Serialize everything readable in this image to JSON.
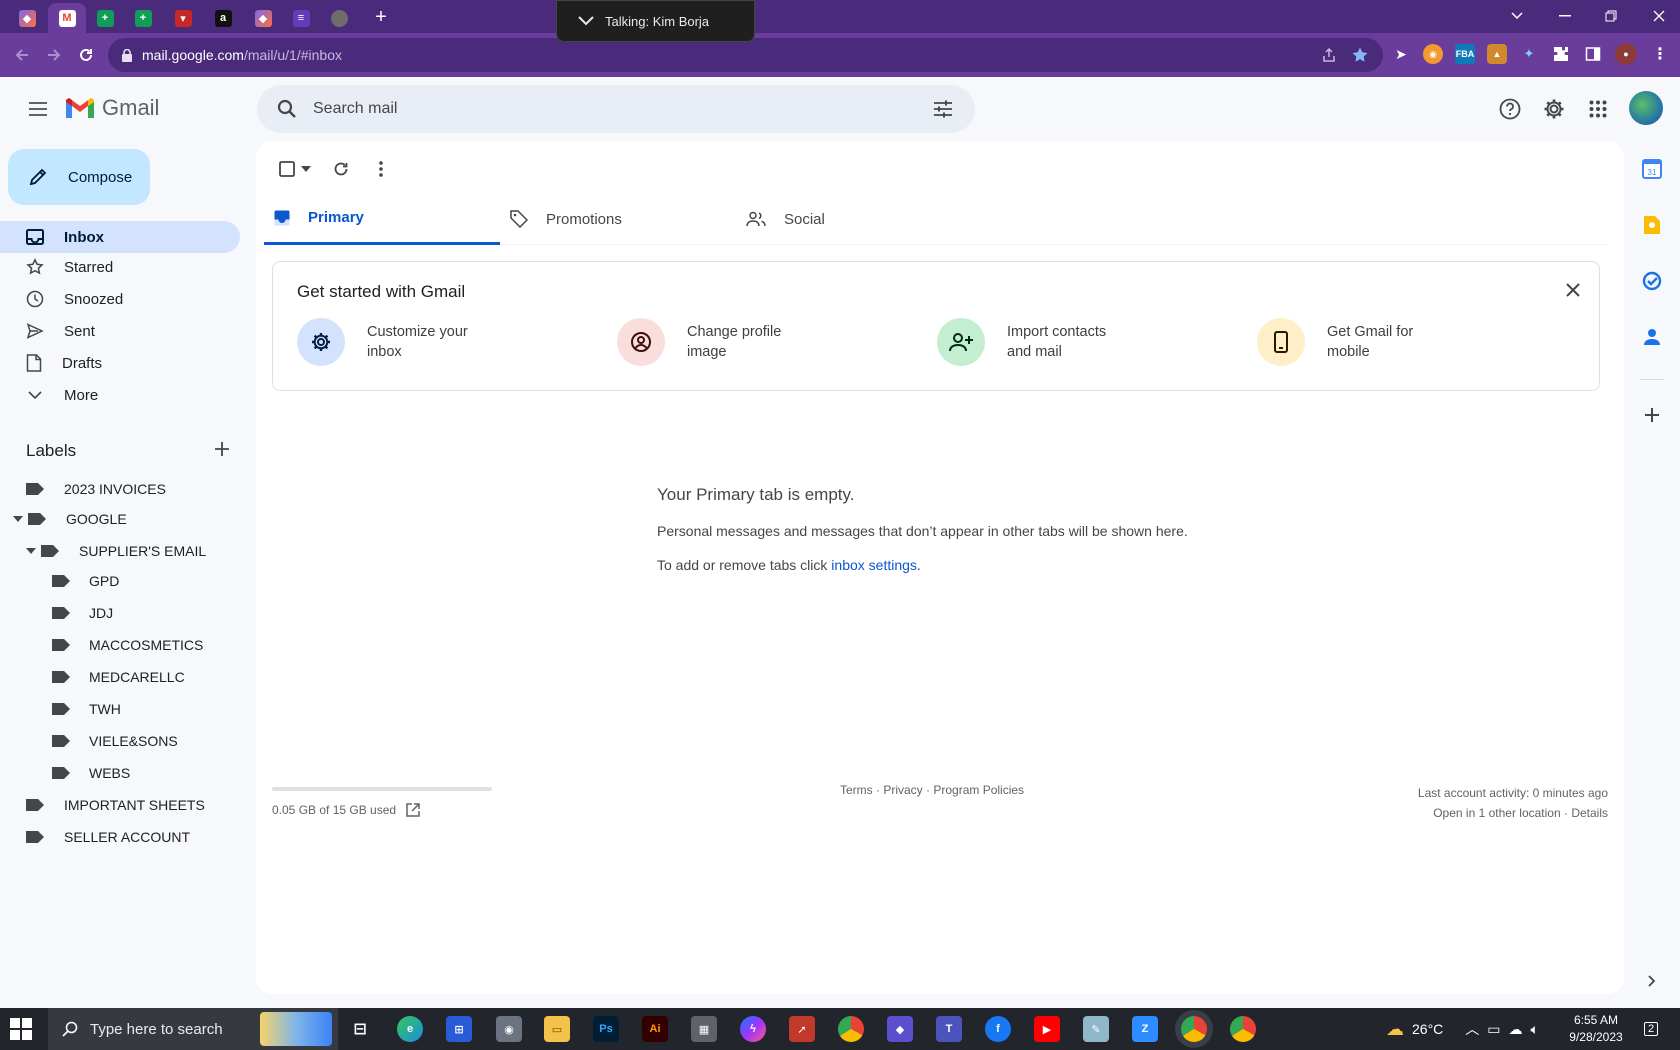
{
  "browser": {
    "tabs": [
      {
        "icon": "clickup-icon"
      },
      {
        "icon": "gmail-icon"
      },
      {
        "icon": "google-sheets-icon"
      },
      {
        "icon": "google-sheets-icon"
      },
      {
        "icon": "tab-site-icon"
      },
      {
        "icon": "amazon-icon"
      },
      {
        "icon": "clickup-icon"
      },
      {
        "icon": "google-forms-icon"
      },
      {
        "icon": "loading-tab-icon"
      }
    ],
    "call_indicator": "Talking: Kim Borja",
    "url_host": "mail.google.com",
    "url_path": "/mail/u/1/#inbox"
  },
  "header": {
    "app_name": "Gmail",
    "search_placeholder": "Search mail"
  },
  "sidebar": {
    "compose_label": "Compose",
    "nav": [
      {
        "label": "Inbox",
        "icon": "inbox-icon"
      },
      {
        "label": "Starred",
        "icon": "star-icon"
      },
      {
        "label": "Snoozed",
        "icon": "clock-icon"
      },
      {
        "label": "Sent",
        "icon": "send-icon"
      },
      {
        "label": "Drafts",
        "icon": "draft-icon"
      },
      {
        "label": "More",
        "icon": "chevron-down-icon"
      }
    ],
    "labels_heading": "Labels",
    "labels": [
      {
        "name": "2023 INVOICES"
      },
      {
        "name": "GOOGLE"
      },
      {
        "name": "SUPPLIER'S EMAIL"
      },
      {
        "name": "GPD"
      },
      {
        "name": "JDJ"
      },
      {
        "name": "MACCOSMETICS"
      },
      {
        "name": "MEDCARELLC"
      },
      {
        "name": "TWH"
      },
      {
        "name": "VIELE&SONS"
      },
      {
        "name": "WEBS"
      },
      {
        "name": "IMPORTANT SHEETS"
      },
      {
        "name": "SELLER ACCOUNT"
      }
    ]
  },
  "main": {
    "tabs": [
      {
        "label": "Primary",
        "icon": "inbox-icon"
      },
      {
        "label": "Promotions",
        "icon": "tag-icon"
      },
      {
        "label": "Social",
        "icon": "people-icon"
      }
    ],
    "get_started": {
      "title": "Get started with Gmail",
      "items": [
        {
          "line1": "Customize your",
          "line2": "inbox",
          "color": "#d3e3fd"
        },
        {
          "line1": "Change profile",
          "line2": "image",
          "color": "#f9dedc"
        },
        {
          "line1": "Import contacts",
          "line2": "and mail",
          "color": "#c4eed0"
        },
        {
          "line1": "Get Gmail for",
          "line2": "mobile",
          "color": "#ffefc9"
        }
      ]
    },
    "empty": {
      "title": "Your Primary tab is empty.",
      "description": "Personal messages and messages that don’t appear in other tabs will be shown here.",
      "tabs_prefix": "To add or remove tabs click ",
      "tabs_link": "inbox settings",
      "tabs_suffix": "."
    },
    "footer": {
      "storage": "0.05 GB of 15 GB used",
      "terms": "Terms",
      "privacy": "Privacy",
      "program_policies": "Program Policies",
      "last_activity": "Last account activity: 0 minutes ago",
      "open_locations": "Open in 1 other location",
      "details": "Details"
    }
  },
  "taskbar": {
    "search_placeholder": "Type here to search",
    "weather": "26°C",
    "time": "6:55 AM",
    "date": "9/28/2023",
    "notification_count": "2"
  },
  "colors": {
    "browser_frame": "#4a2a7a",
    "active_nav": "#d3e3fd",
    "compose": "#c2e7ff",
    "accent_blue": "#0b57d0"
  }
}
